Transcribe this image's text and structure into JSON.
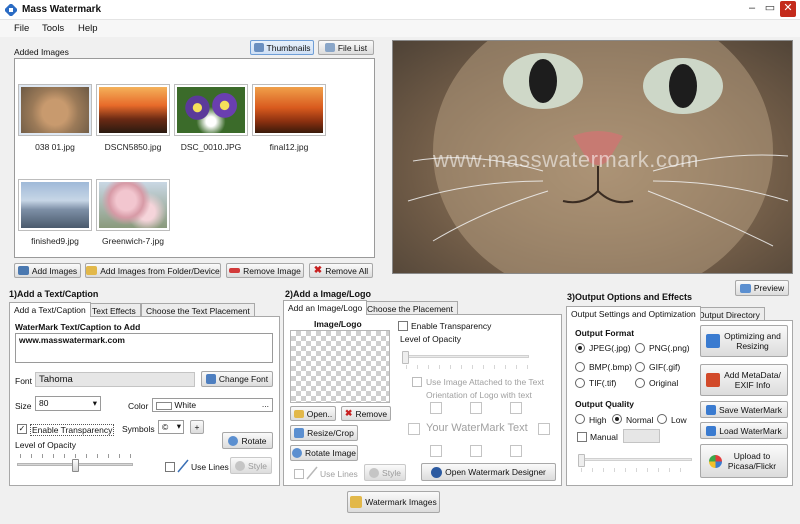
{
  "window": {
    "title": "Mass Watermark"
  },
  "menu": [
    "File",
    "Tools",
    "Help"
  ],
  "images_panel": {
    "label": "Added Images",
    "view_thumbnails": "Thumbnails",
    "view_file_list": "File List",
    "images": [
      {
        "name": "038 01.jpg",
        "selected": true
      },
      {
        "name": "DSCN5850.jpg",
        "selected": false
      },
      {
        "name": "DSC_0010.JPG",
        "selected": false
      },
      {
        "name": "final12.jpg",
        "selected": false
      },
      {
        "name": "finished9.jpg",
        "selected": false
      },
      {
        "name": "Greenwich-7.jpg",
        "selected": false
      }
    ],
    "add_images": "Add Images",
    "add_from_folder": "Add Images from Folder/Device",
    "remove_image": "Remove Image",
    "remove_all": "Remove All"
  },
  "preview": {
    "watermark_text": "www.masswatermark.com",
    "button": "Preview"
  },
  "text_section": {
    "title": "1)Add a Text/Caption",
    "tabs": [
      "Add a Text/Caption",
      "Text Effects",
      "Choose the Text Placement"
    ],
    "caption_label": "WaterMark Text/Caption to Add",
    "caption_value": "www.masswatermark.com",
    "font_label": "Font",
    "font_value": "Tahoma",
    "change_font": "Change Font",
    "size_label": "Size",
    "size_value": "80",
    "color_label": "Color",
    "color_value": "White",
    "color_more": "...",
    "enable_transparency": "Enable Transparency",
    "symbols_label": "Symbols",
    "symbols_value": "©",
    "symbols_add": "+",
    "rotate": "Rotate",
    "opacity_label": "Level of Opacity",
    "opacity_level": 0.5,
    "use_lines": "Use Lines",
    "style": "Style"
  },
  "image_section": {
    "title": "2)Add a Image/Logo",
    "tabs": [
      "Add an Image/Logo",
      "Choose the Placement"
    ],
    "logo_label": "Image/Logo",
    "open": "Open..",
    "remove": "Remove",
    "resize_crop": "Resize/Crop",
    "rotate_image": "Rotate Image",
    "enable_transparency": "Enable Transparency",
    "opacity_label": "Level of Opacity",
    "use_attached": "Use Image Attached to the Text",
    "orientation_label": "Orientation of Logo with text",
    "placeholder_text": "Your WaterMark Text",
    "use_lines": "Use Lines",
    "style": "Style",
    "designer": "Open Watermark Designer"
  },
  "output_section": {
    "title": "3)Output Options and Effects",
    "tabs": [
      "Output Settings and Optimization",
      "Output Directory"
    ],
    "format_label": "Output Format",
    "formats": [
      "JPEG(.jpg)",
      "PNG(.png)",
      "BMP(.bmp)",
      "GIF(.gif)",
      "TIF(.tif)",
      "Original"
    ],
    "selected_format": "JPEG(.jpg)",
    "quality_label": "Output Quality",
    "qualities": [
      "High",
      "Normal",
      "Low"
    ],
    "selected_quality": "Normal",
    "manual": "Manual",
    "optimizing": "Optimizing and Resizing",
    "metadata": "Add MetaData/ EXIF Info",
    "save_watermark": "Save WaterMark",
    "load_watermark": "Load WaterMark",
    "upload": "Upload to Picasa/Flickr"
  },
  "watermark_images": "Watermark Images",
  "colors": {
    "accent": "#316ac5",
    "close": "#c42b1c"
  }
}
